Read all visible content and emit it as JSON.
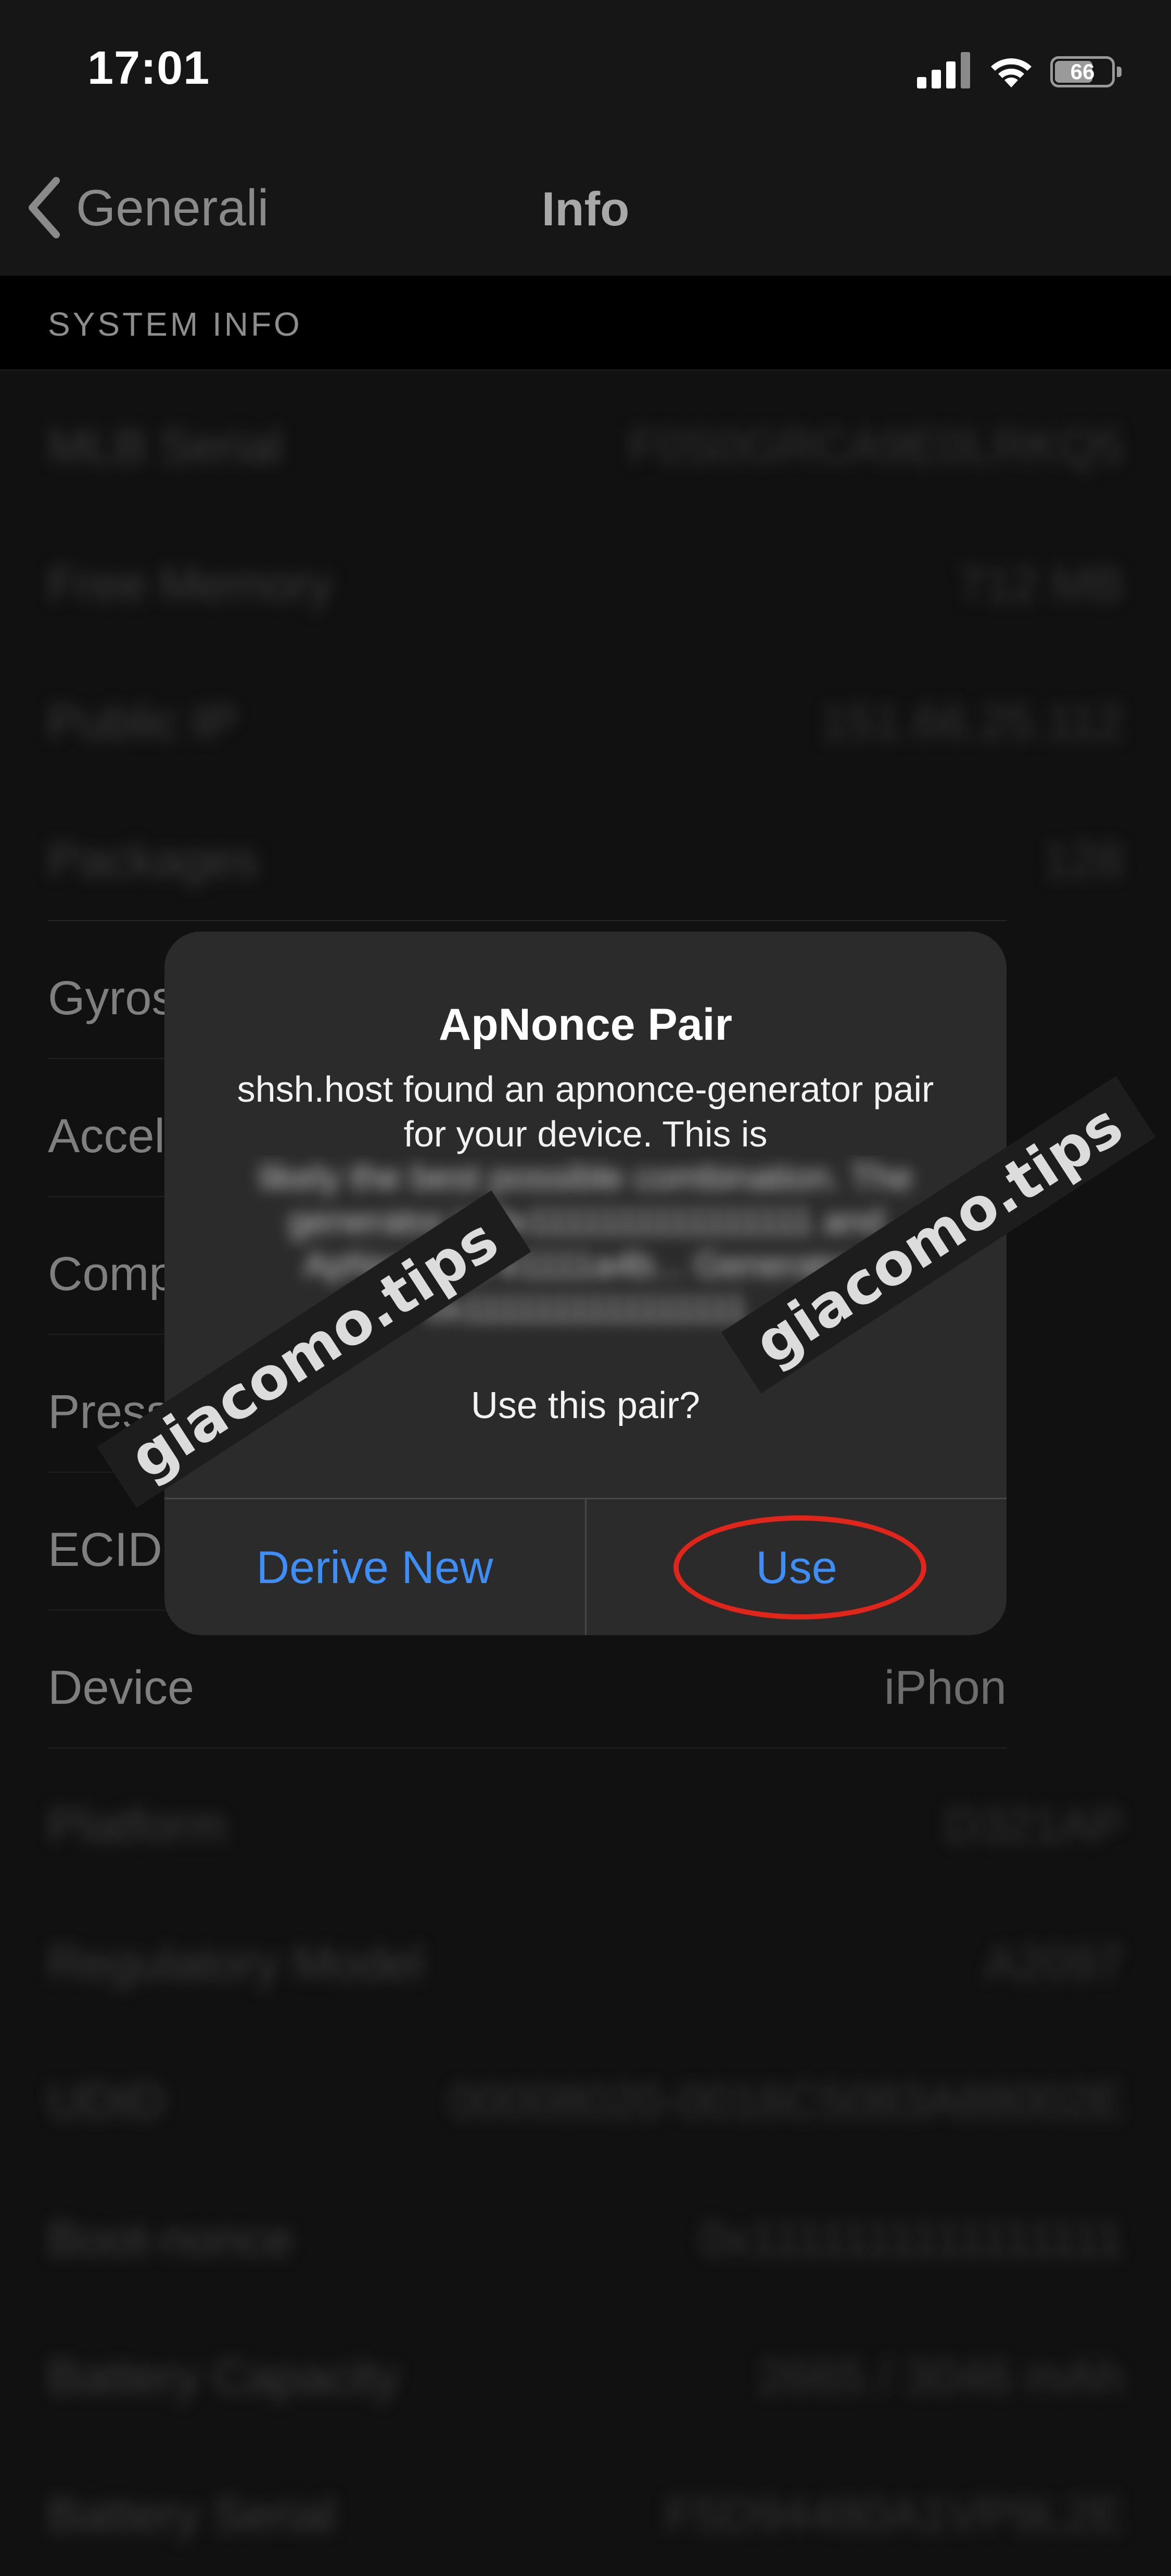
{
  "status_bar": {
    "time": "17:01",
    "battery_level": "66",
    "icons": [
      "cellular-signal-icon",
      "wifi-icon",
      "battery-icon"
    ]
  },
  "nav": {
    "back_label": "Generali",
    "title": "Info"
  },
  "section": {
    "header": "SYSTEM INFO"
  },
  "rows_top": [
    {
      "label": "MLB Serial",
      "value": "F0S0GRCA9E0LRKQ5"
    },
    {
      "label": "Free Memory",
      "value": "712 MB"
    },
    {
      "label": "Public IP",
      "value": "151.66.25.112"
    },
    {
      "label": "Packages",
      "value": "128"
    }
  ],
  "rows_mid": [
    {
      "label": "Gyros",
      "value": ""
    },
    {
      "label": "Accel",
      "value": ""
    },
    {
      "label": "Comp",
      "value": ""
    },
    {
      "label": "Press",
      "value": ""
    },
    {
      "label": "ECID",
      "value": ""
    },
    {
      "label": "Device",
      "value": "iPhon"
    }
  ],
  "rows_bottom": [
    {
      "label": "Platform",
      "value": "D321AP"
    },
    {
      "label": "Regulatory Model",
      "value": "A2097"
    },
    {
      "label": "UDID",
      "value": "00008020-0016C5083A88002E"
    },
    {
      "label": "Boot-nonce",
      "value": "0x1111111111111111"
    },
    {
      "label": "Battery Capacity",
      "value": "2665 / 3046 mAh"
    },
    {
      "label": "Battery Serial",
      "value": "F5D94480A1VP9L2E"
    }
  ],
  "alert": {
    "title": "ApNonce Pair",
    "message": "shsh.host found an apnonce-generator pair for your device. This is",
    "obscured_message": "likely the best possible combination. The generator is 0x1111111111111111 and ApNonce is e1111a4b... Generator: 0x1111111111111111",
    "question": "Use this pair?",
    "button_derive": "Derive New",
    "button_use": "Use"
  },
  "watermark": "giacomo.tips",
  "colors": {
    "accent": "#3f8ef7",
    "highlight_circle": "#e0251a",
    "background": "#111111",
    "alert_background": "#2b2b2b"
  }
}
